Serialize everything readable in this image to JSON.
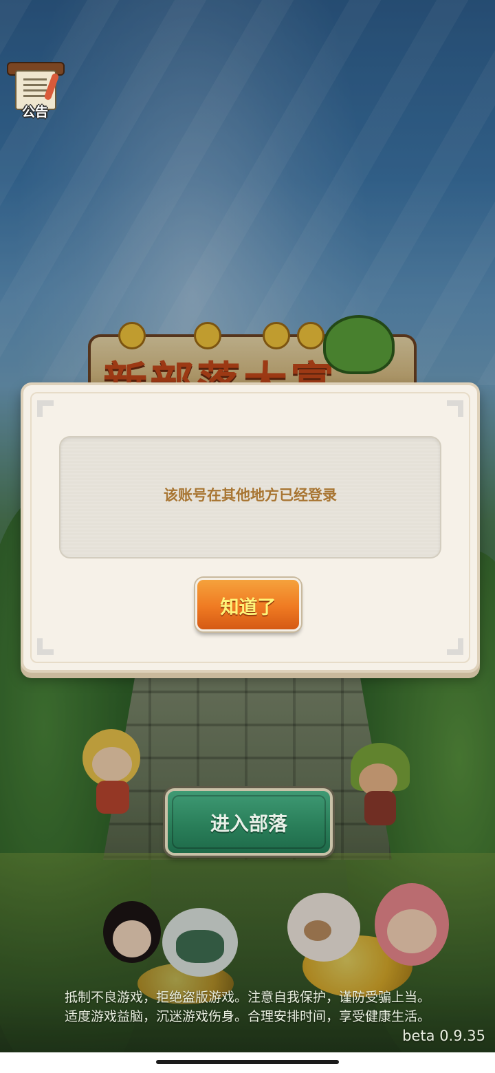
{
  "notice": {
    "label": "公告",
    "icon": "notice-scroll-icon"
  },
  "logo": {
    "title": "新部落大富"
  },
  "dialog": {
    "message": "该账号在其他地方已经登录",
    "confirm_label": "知道了"
  },
  "enter_button": {
    "label": "进入部落"
  },
  "health_notice": {
    "line1": "抵制不良游戏，拒绝盗版游戏。注意自我保护，谨防受骗上当。",
    "line2": "适度游戏益脑，沉迷游戏伤身。合理安排时间，享受健康生活。"
  },
  "version": "beta 0.9.35",
  "colors": {
    "dialog_bg": "#f6f1e8",
    "message_text": "#a87532",
    "confirm_button": "#ef7a22",
    "confirm_text": "#fdf47a",
    "enter_button": "#2a7f5a"
  }
}
